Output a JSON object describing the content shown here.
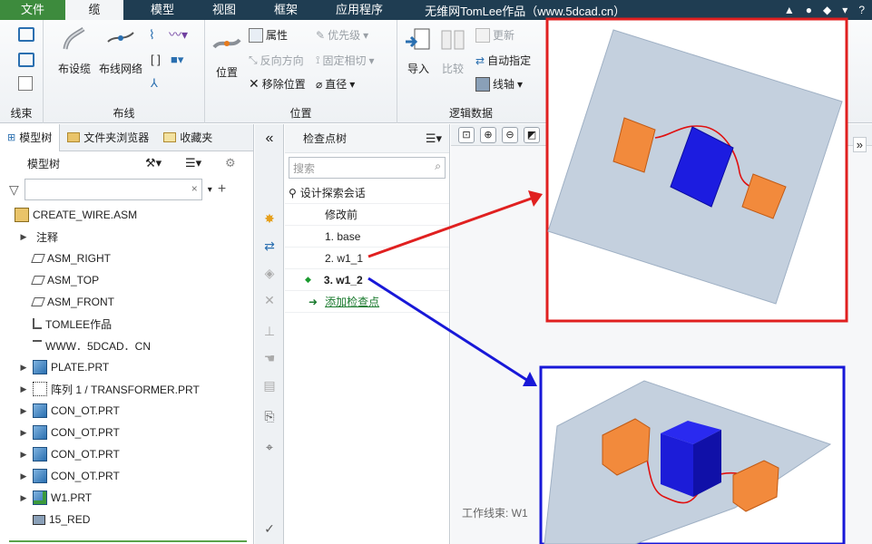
{
  "tabs": {
    "file": "文件",
    "wire": "缆",
    "model": "模型",
    "view": "视图",
    "frame": "框架",
    "apps": "应用程序"
  },
  "window_title": "无维网TomLee作品（www.5dcad.cn）",
  "ribbon": {
    "group_cable_bundle": "线束",
    "group_routing": "布线",
    "group_location": "位置",
    "group_logic": "逻辑数据",
    "btn_route_cable": "布设缆",
    "btn_route_network": "布线网络",
    "btn_location": "位置",
    "btn_properties": "属性",
    "btn_reverse": "反向方向",
    "btn_remove_location": "移除位置",
    "btn_priority": "优先级",
    "btn_fixed_phase": "固定相切",
    "btn_diameter": "直径",
    "btn_import": "导入",
    "btn_compare": "比较",
    "btn_update": "更新",
    "btn_auto_assign": "自动指定",
    "btn_spool": "线轴"
  },
  "left_panel": {
    "tab_model_tree": "模型树",
    "tab_folder_browser": "文件夹浏览器",
    "tab_favorites": "收藏夹",
    "header": "模型树",
    "filter_value": "",
    "items": [
      {
        "label": "CREATE_WIRE.ASM",
        "icon": "assembly-icon",
        "expandable": false,
        "root": true
      },
      {
        "label": "注释",
        "icon": "",
        "expandable": true
      },
      {
        "label": "ASM_RIGHT",
        "icon": "datum-plane-icon",
        "expandable": false
      },
      {
        "label": "ASM_TOP",
        "icon": "datum-plane-icon",
        "expandable": false
      },
      {
        "label": "ASM_FRONT",
        "icon": "datum-plane-icon",
        "expandable": false
      },
      {
        "label": "TOMLEE作品",
        "icon": "coordinate-system-icon",
        "expandable": false
      },
      {
        "label": "WWW．5DCAD．CN",
        "icon": "note-icon",
        "expandable": false
      },
      {
        "label": "PLATE.PRT",
        "icon": "part-icon",
        "expandable": true
      },
      {
        "label": "阵列 1 / TRANSFORMER.PRT",
        "icon": "pattern-icon",
        "expandable": true
      },
      {
        "label": "CON_OT.PRT",
        "icon": "part-icon",
        "expandable": true
      },
      {
        "label": "CON_OT.PRT",
        "icon": "part-icon",
        "expandable": true
      },
      {
        "label": "CON_OT.PRT",
        "icon": "part-icon",
        "expandable": true
      },
      {
        "label": "CON_OT.PRT",
        "icon": "part-icon",
        "expandable": true
      },
      {
        "label": "W1.PRT",
        "icon": "wire-part-icon",
        "expandable": true
      },
      {
        "label": "15_RED",
        "icon": "spool-icon",
        "expandable": false
      }
    ]
  },
  "check_panel": {
    "header": "检查点树",
    "search_placeholder": "搜索",
    "session": "设计探索会话",
    "items": [
      "修改前",
      "1. base",
      "2. w1_1",
      "3. w1_2"
    ],
    "selected_index": 3,
    "add_checkpoint": "添加检查点"
  },
  "graphics": {
    "status_text": "工作线束: W1",
    "more": "»",
    "top_highlight_color": "#e02020",
    "bottom_highlight_color": "#1818d8",
    "plate_color": "#c4d0de",
    "block_color": "#1c1ce0",
    "connector_color": "#f28a3c",
    "wire_color": "#e01010"
  },
  "sysbar": {
    "help": "?"
  }
}
